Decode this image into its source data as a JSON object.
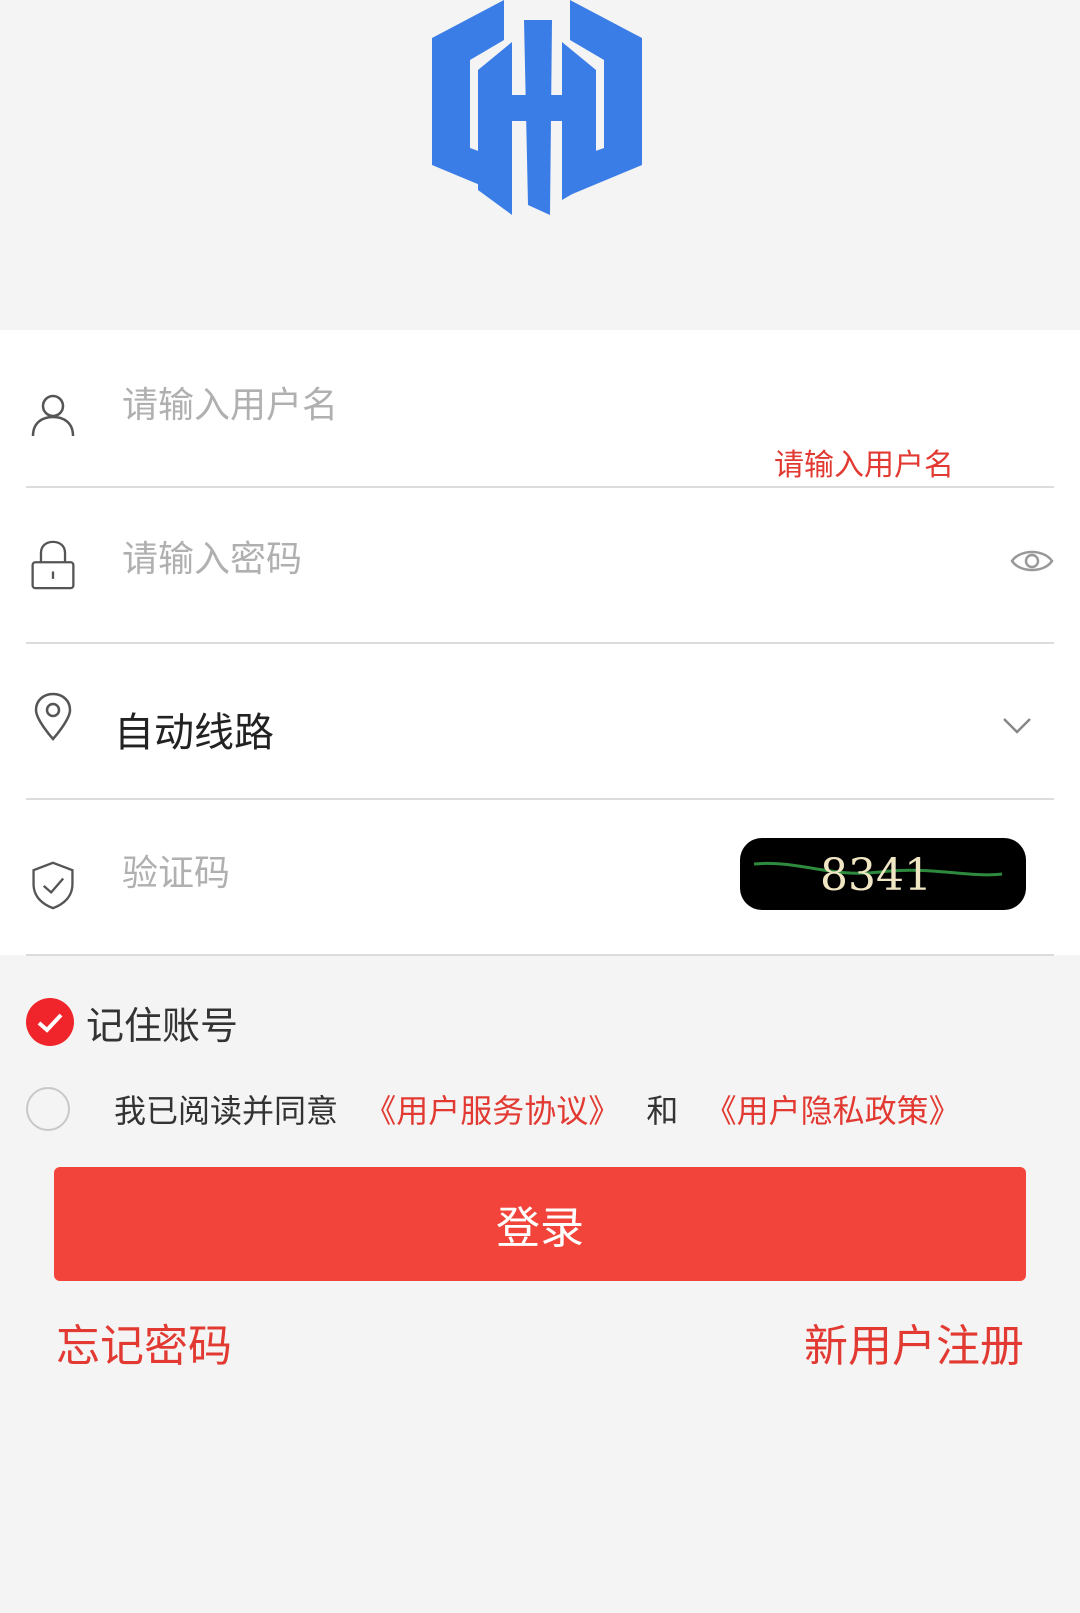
{
  "brand": {
    "logo_letter": "H",
    "color": "#3b7de6"
  },
  "username": {
    "placeholder": "请输入用户名",
    "error": "请输入用户名"
  },
  "password": {
    "placeholder": "请输入密码"
  },
  "route": {
    "selected": "自动线路"
  },
  "captcha": {
    "placeholder": "验证码",
    "code": "8341"
  },
  "remember": {
    "label": "记住账号",
    "checked": true
  },
  "agreement": {
    "prefix": "我已阅读并同意",
    "service_link": "《用户服务协议》",
    "and": "和",
    "privacy_link": "《用户隐私政策》",
    "checked": false
  },
  "login": {
    "label": "登录"
  },
  "links": {
    "forgot": "忘记密码",
    "register": "新用户注册"
  },
  "colors": {
    "accent": "#f2443a",
    "link": "#e23a32"
  }
}
